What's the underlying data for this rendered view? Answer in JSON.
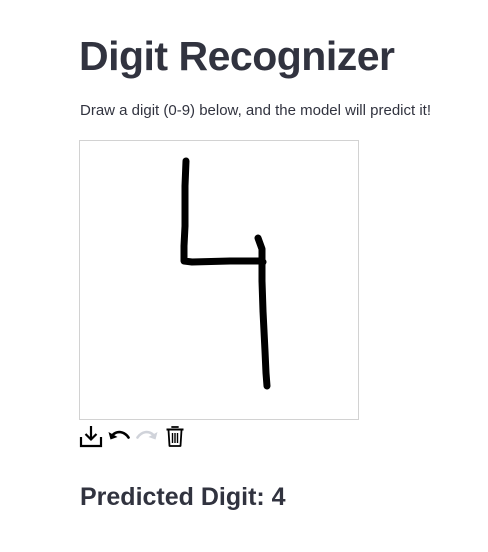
{
  "page": {
    "title": "Digit Recognizer",
    "instructions": "Draw a digit (0-9) below, and the model will predict it!"
  },
  "canvas": {
    "background_color": "#ffffff",
    "border_color": "#d2d2d2",
    "stroke_color": "#000000",
    "drawn_digit": "4"
  },
  "toolbar": {
    "tools": [
      {
        "name": "download-icon",
        "enabled": true
      },
      {
        "name": "undo-icon",
        "enabled": true
      },
      {
        "name": "redo-icon",
        "enabled": false
      },
      {
        "name": "trash-icon",
        "enabled": true
      }
    ],
    "enabled_color": "#000000",
    "disabled_color": "#d0d3da"
  },
  "result": {
    "prediction_text": "Predicted Digit: 4"
  }
}
